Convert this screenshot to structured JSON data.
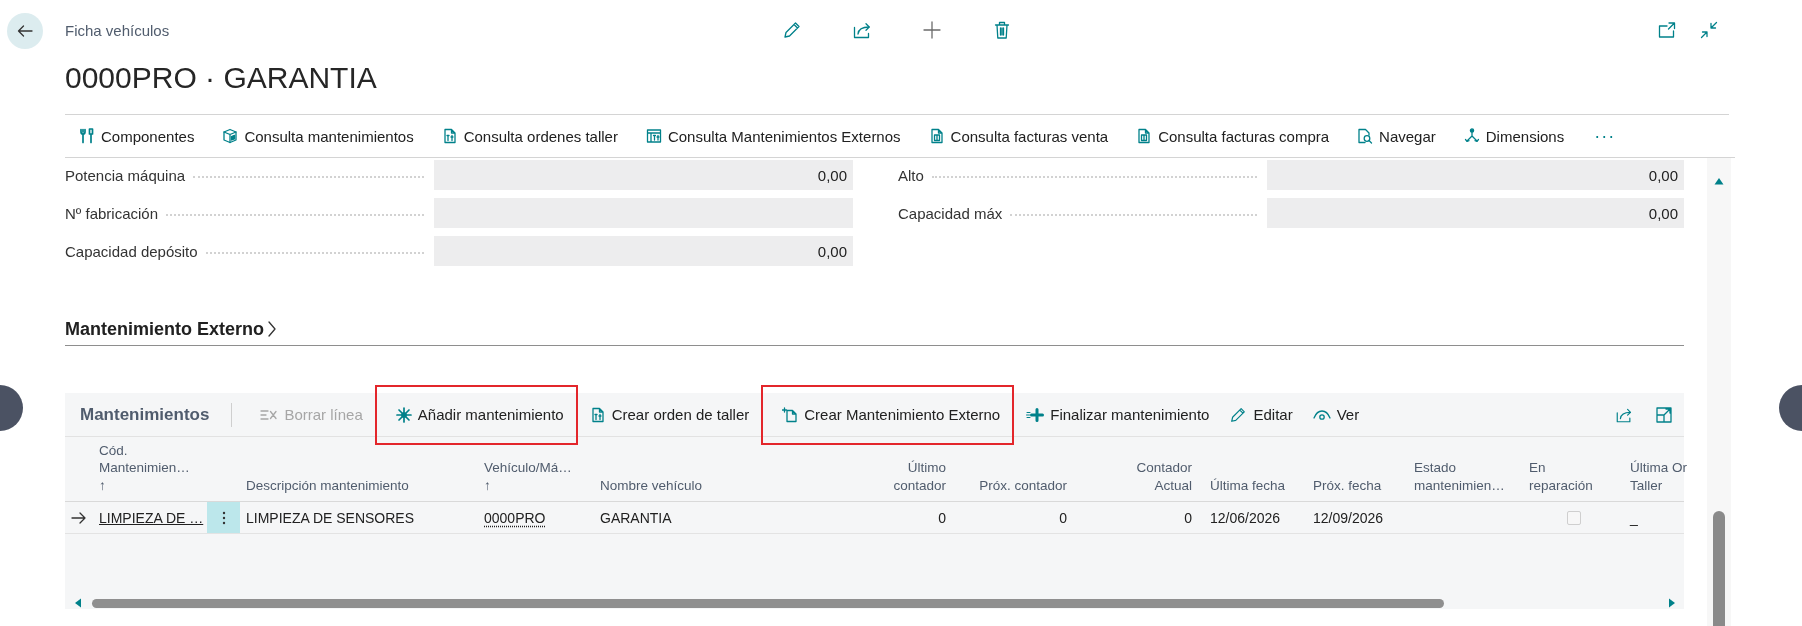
{
  "page": {
    "breadcrumb": "Ficha vehículos",
    "title": "0000PRO · GARANTIA"
  },
  "action_bar": {
    "items": [
      {
        "label": "Componentes"
      },
      {
        "label": "Consulta mantenimientos"
      },
      {
        "label": "Consulta ordenes taller"
      },
      {
        "label": "Consulta Mantenimientos Externos"
      },
      {
        "label": "Consulta facturas venta"
      },
      {
        "label": "Consulta facturas compra"
      },
      {
        "label": "Navegar"
      },
      {
        "label": "Dimensions"
      }
    ],
    "more": "···"
  },
  "general": {
    "columns": [
      [
        {
          "label": "Potencia máquina",
          "value": "0,00"
        },
        {
          "label": "Nº fabricación"
        },
        {
          "label": "Capacidad depósito",
          "value": "0,00"
        }
      ],
      [
        {
          "label": "Alto",
          "value": "0,00"
        },
        {
          "label": "Capacidad máx",
          "value": "0,00"
        }
      ]
    ]
  },
  "section": {
    "title": "Mantenimiento Externo"
  },
  "subpage": {
    "title": "Mantenimientos",
    "actions": [
      {
        "label": "Borrar línea",
        "disabled": true,
        "highlighted": false
      },
      {
        "label": "Añadir mantenimiento",
        "disabled": false,
        "highlighted": true
      },
      {
        "label": "Crear orden de taller",
        "disabled": false,
        "highlighted": false
      },
      {
        "label": "Crear Mantenimiento Externo",
        "disabled": false,
        "highlighted": true
      },
      {
        "label": "Finalizar mantenimiento",
        "disabled": false,
        "highlighted": false
      },
      {
        "label": "Editar",
        "disabled": false,
        "highlighted": false
      },
      {
        "label": "Ver",
        "disabled": false,
        "highlighted": false
      }
    ],
    "columns": [
      {
        "lines": [
          "Cód.",
          "Mantenimien…"
        ],
        "sort": "↑",
        "kind": "text"
      },
      {
        "lines": [
          "Descripción mantenimiento"
        ],
        "kind": "text"
      },
      {
        "lines": [
          "Vehículo/Má…"
        ],
        "sort": "↑",
        "kind": "text"
      },
      {
        "lines": [
          "Nombre vehículo"
        ],
        "kind": "text"
      },
      {
        "lines": [
          "Último",
          "contador"
        ],
        "kind": "number"
      },
      {
        "lines": [
          "Próx. contador"
        ],
        "kind": "number"
      },
      {
        "lines": [
          "Contador",
          "Actual"
        ],
        "kind": "number"
      },
      {
        "lines": [
          "Última fecha"
        ],
        "kind": "text"
      },
      {
        "lines": [
          "Próx. fecha"
        ],
        "kind": "text"
      },
      {
        "lines": [
          "Estado",
          "mantenimien…"
        ],
        "kind": "text"
      },
      {
        "lines": [
          "En",
          "reparación"
        ],
        "kind": "boolean"
      },
      {
        "lines": [
          "Última Or",
          "Taller"
        ],
        "kind": "text"
      }
    ],
    "rows": [
      {
        "current": true,
        "cells": [
          {
            "kind": "link",
            "text": "LIMPIEZA DE …"
          },
          {
            "kind": "text",
            "text": "LIMPIEZA DE SENSORES"
          },
          {
            "kind": "lookup",
            "text": "0000PRO"
          },
          {
            "kind": "text",
            "text": "GARANTIA"
          },
          {
            "kind": "number",
            "text": "0"
          },
          {
            "kind": "number",
            "text": "0"
          },
          {
            "kind": "number",
            "text": "0"
          },
          {
            "kind": "text",
            "text": "12/06/2026"
          },
          {
            "kind": "text",
            "text": "12/09/2026"
          },
          null,
          {
            "kind": "checkbox",
            "checked": false,
            "disabled": true
          },
          {
            "kind": "text",
            "text": "_"
          }
        ]
      }
    ]
  }
}
